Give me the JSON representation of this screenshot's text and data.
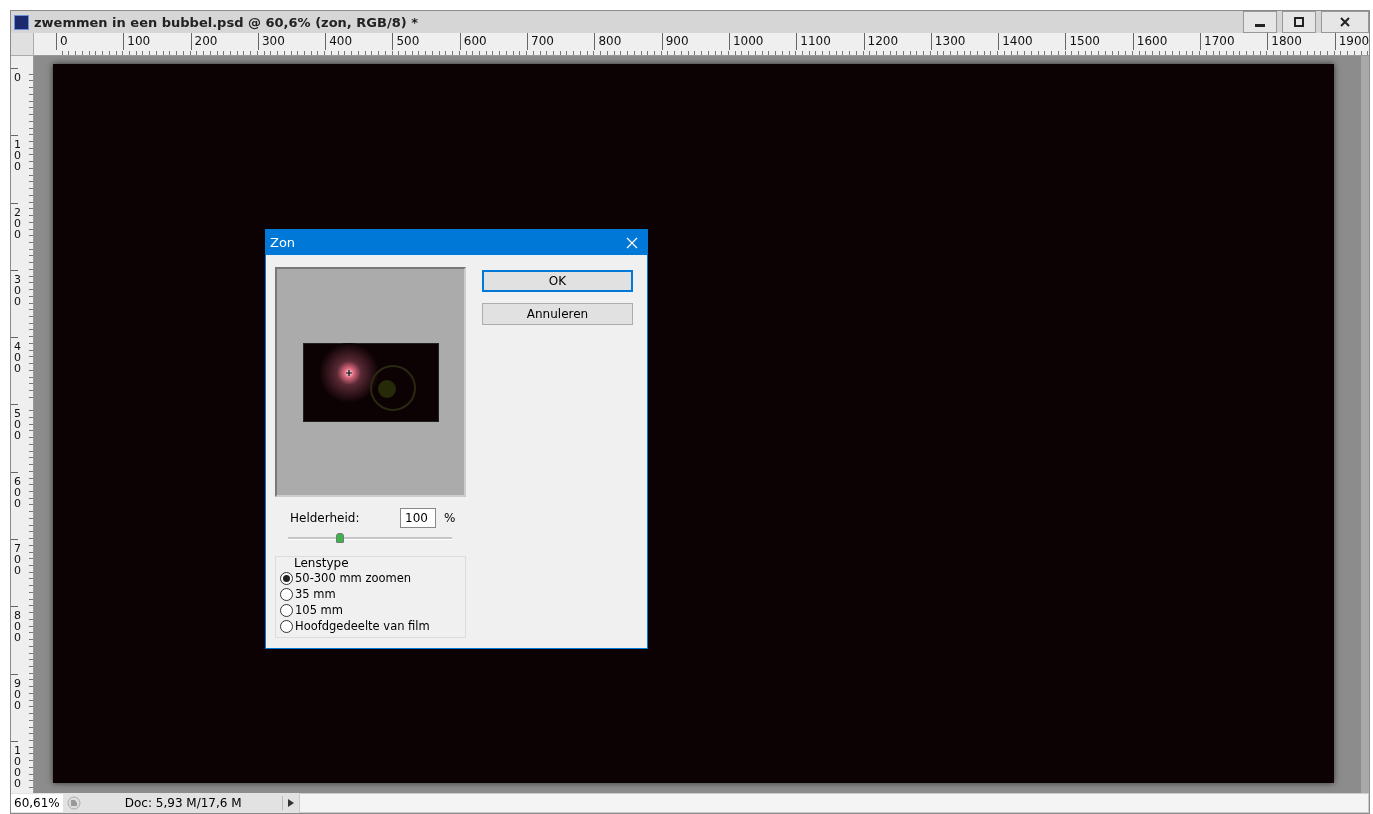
{
  "window": {
    "title": "zwemmen in een bubbel.psd @ 60,6% (zon, RGB/8) *"
  },
  "ruler_horizontal": [
    "0",
    "100",
    "200",
    "300",
    "400",
    "500",
    "600",
    "700",
    "800",
    "900",
    "1000",
    "1100",
    "1200",
    "1300",
    "1400",
    "1500",
    "1600",
    "1700",
    "1800",
    "1900"
  ],
  "ruler_vertical": [
    "0",
    "100",
    "200",
    "300",
    "400",
    "500",
    "600",
    "700",
    "800",
    "900",
    "1000"
  ],
  "dialog": {
    "title": "Zon",
    "buttons": [
      {
        "label": "OK",
        "focused": true
      },
      {
        "label": "Annuleren",
        "focused": false
      }
    ],
    "brightness": {
      "label": "Helderheid:",
      "value": "100",
      "unit": "%",
      "level": 0.32
    },
    "lens_type": {
      "label": "Lenstype",
      "options": [
        {
          "label": "50-300 mm zoomen",
          "selected": true
        },
        {
          "label": "35 mm",
          "selected": false
        },
        {
          "label": "105 mm",
          "selected": false
        },
        {
          "label": "Hoofdgedeelte van film",
          "selected": false
        }
      ]
    }
  },
  "status_bar": {
    "zoom": "60,61%",
    "doc": "Doc: 5,93 M/17,6 M"
  }
}
